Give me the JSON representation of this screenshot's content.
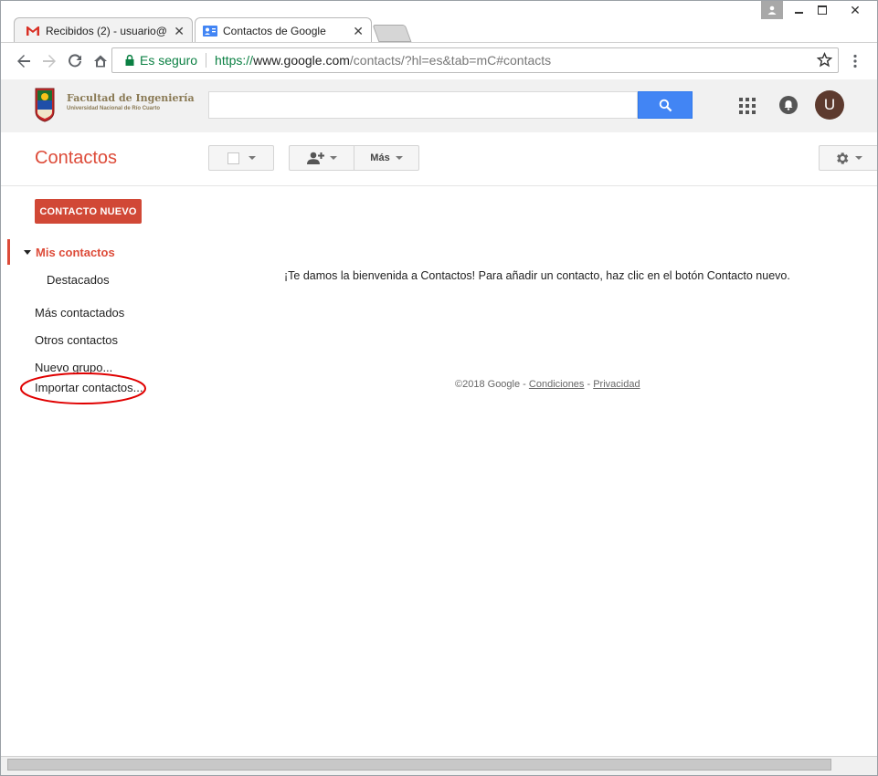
{
  "browser": {
    "tabs": [
      {
        "title": "Recibidos (2) - usuario@",
        "active": false
      },
      {
        "title": "Contactos de Google",
        "active": true
      }
    ],
    "secure_label": "Es seguro",
    "url_scheme": "https://",
    "url_host": "www.google.com",
    "url_path": "/contacts/?hl=es&tab=mC#contacts"
  },
  "header": {
    "logo_line1": "Facultad de Ingeniería",
    "logo_line2": "Universidad Nacional de Río Cuarto",
    "search_placeholder": "",
    "avatar_letter": "U"
  },
  "toolbar": {
    "app_title": "Contactos",
    "more_label": "Más"
  },
  "sidebar": {
    "new_contact": "CONTACTO NUEVO",
    "my_contacts": "Mis contactos",
    "starred": "Destacados",
    "most_contacted": "Más contactados",
    "other_contacts": "Otros contactos",
    "new_group": "Nuevo grupo...",
    "import_contacts": "Importar contactos..."
  },
  "main": {
    "welcome": "¡Te damos la bienvenida a Contactos! Para añadir un contacto, haz clic en el botón Contacto nuevo.",
    "footer_copy": "©2018 Google - ",
    "footer_terms": "Condiciones",
    "footer_sep": " - ",
    "footer_privacy": "Privacidad"
  },
  "colors": {
    "accent_red": "#d14836",
    "title_red": "#dd4b39",
    "search_blue": "#4285f4",
    "secure_green": "#0b8043",
    "annotation_red": "#e00000"
  },
  "icons": [
    "gmail-icon",
    "contacts-icon",
    "close-icon",
    "back-icon",
    "forward-icon",
    "reload-icon",
    "home-icon",
    "lock-icon",
    "star-icon",
    "menu-icon",
    "search-icon",
    "apps-icon",
    "notifications-icon",
    "gear-icon",
    "add-person-icon",
    "checkbox-icon"
  ]
}
